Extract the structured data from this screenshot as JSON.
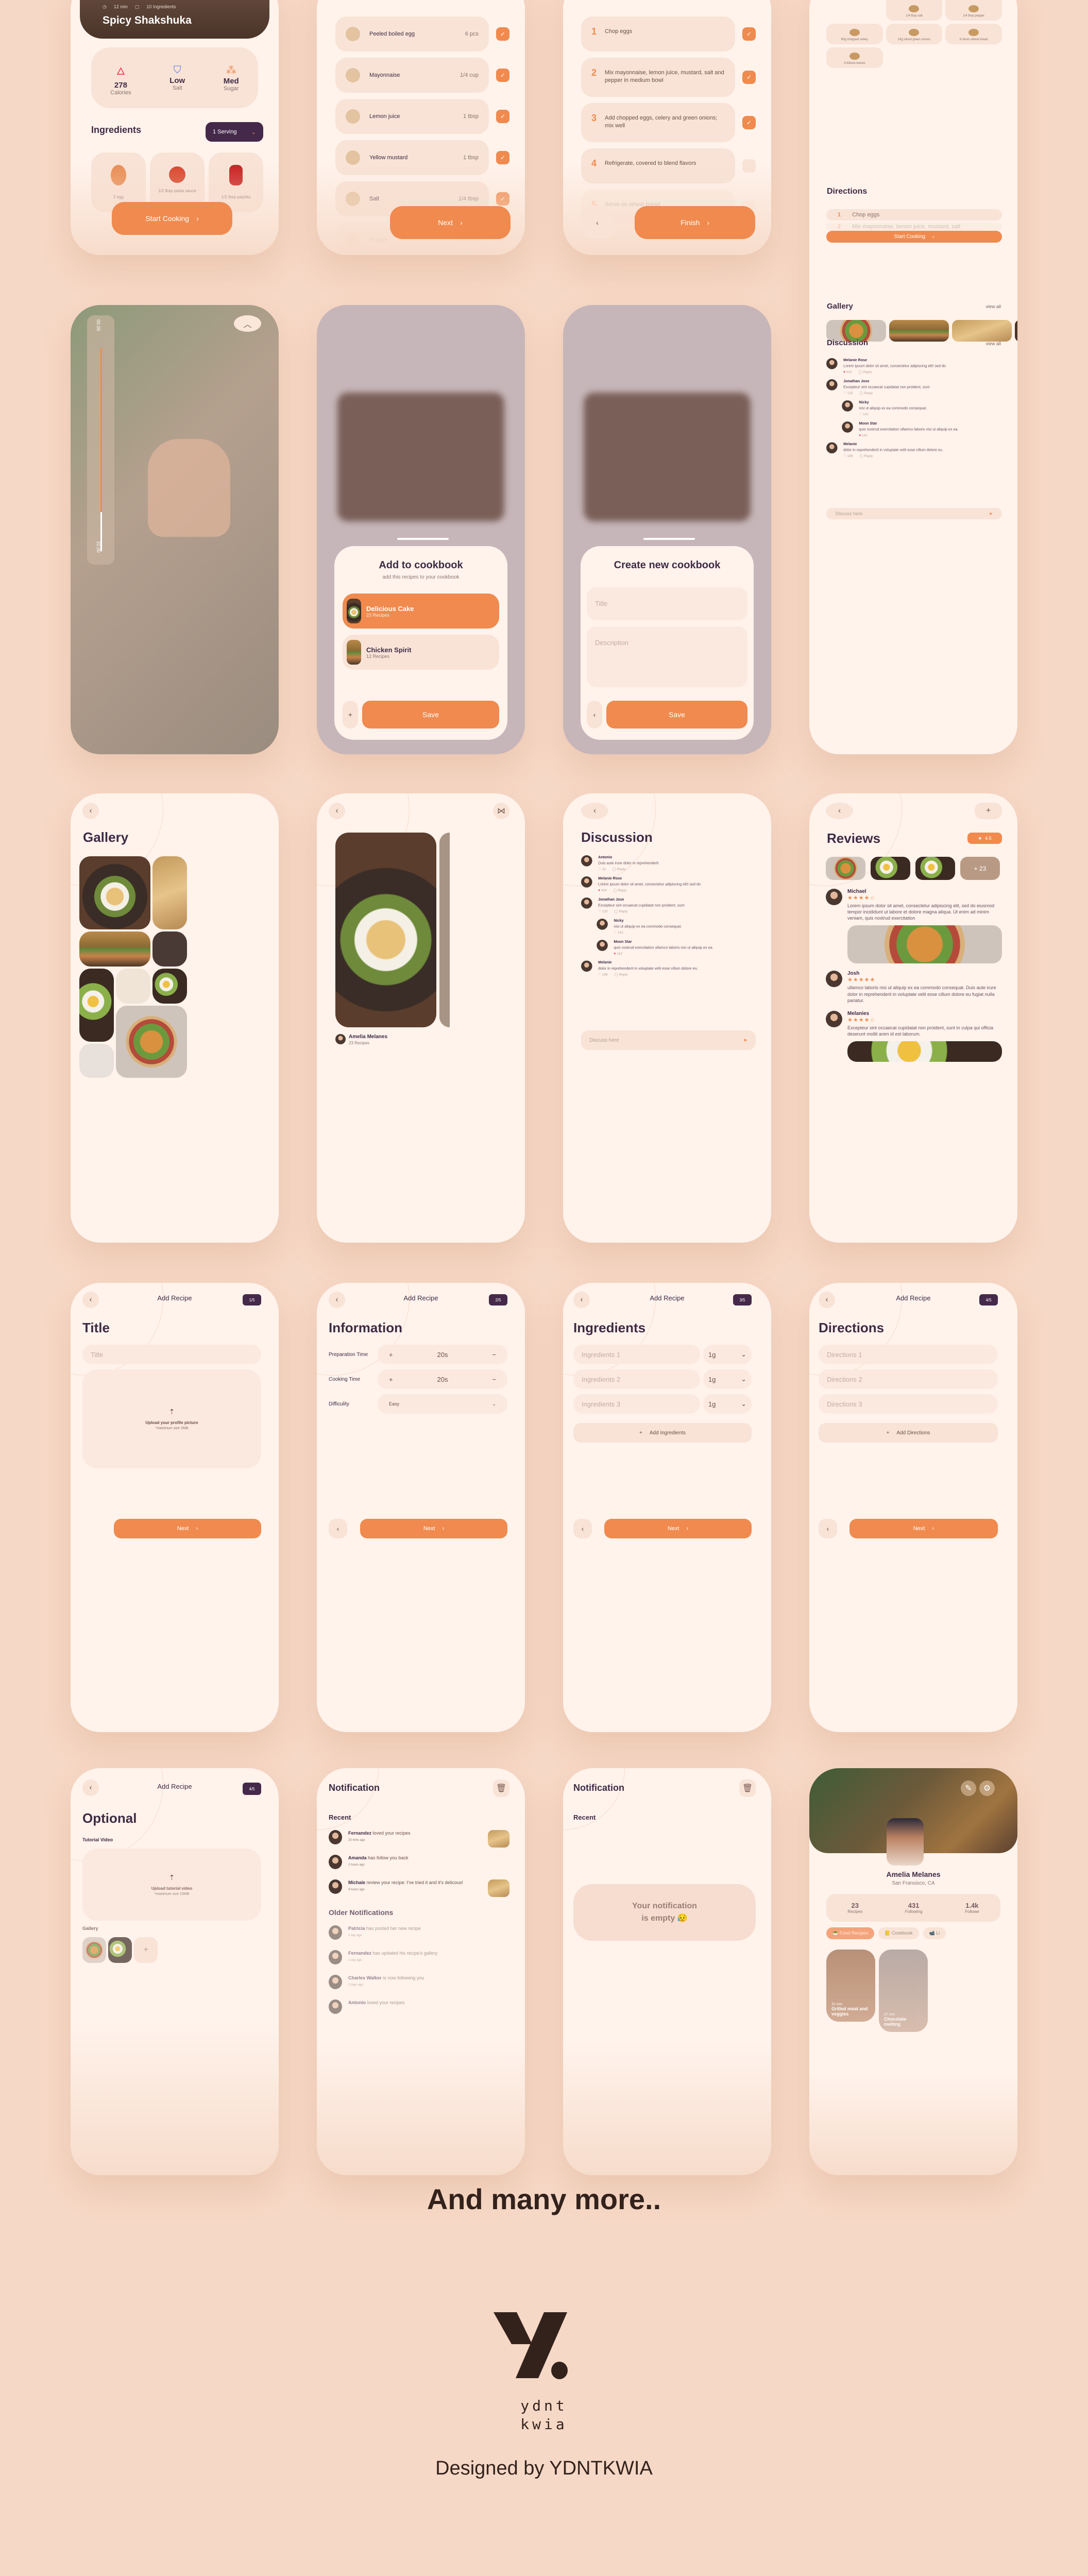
{
  "colors": {
    "accent": "#f08a4e",
    "dark": "#3e2a45",
    "background": "#f6d8c6",
    "card": "#fff3ec",
    "chip": "#f8e3d6",
    "heart": "#ef3b55"
  },
  "recipe": {
    "meta_time": "12 min",
    "meta_ingredients": "10 Ingredients",
    "title": "Spicy Shakshuka",
    "nutrition": [
      {
        "icon": "flame-icon",
        "value": "278",
        "label": "Calories"
      },
      {
        "icon": "salt-shaker-icon",
        "value": "Low",
        "label": "Salt"
      },
      {
        "icon": "sugar-cubes-icon",
        "value": "Med",
        "label": "Sugar"
      }
    ],
    "ingredients_title": "Ingredients",
    "serving_select": "1 Serving",
    "ingredients": [
      {
        "label": "2 egg"
      },
      {
        "label": "1/2 tbsp pasta sauce"
      },
      {
        "label": "1/2 tbsp paprika"
      }
    ],
    "start_button": "Start Cooking"
  },
  "checklist": {
    "items": [
      {
        "name": "Peeled boiled egg",
        "qty": "6 pcs",
        "checked": true
      },
      {
        "name": "Mayonnaise",
        "qty": "1/4 cup",
        "checked": true
      },
      {
        "name": "Lemon juice",
        "qty": "1 tbsp",
        "checked": true
      },
      {
        "name": "Yellow mustard",
        "qty": "1 tbsp",
        "checked": true
      },
      {
        "name": "Salt",
        "qty": "1/4 tbsp",
        "checked": true
      },
      {
        "name": "Pepper",
        "qty": "1/4 tbsp",
        "checked": false
      }
    ],
    "next_button": "Next"
  },
  "steps": {
    "items": [
      {
        "num": "1",
        "text": "Chop eggs",
        "checked": true
      },
      {
        "num": "2",
        "text": "Mix mayonnaise, lemon juice, mustard, salt and pepper in medium bowl",
        "checked": true
      },
      {
        "num": "3",
        "text": "Add chopped eggs, celery and green onions; mix well",
        "checked": true
      },
      {
        "num": "4",
        "text": "Refrigerate, covered to blend flavors",
        "checked": false
      },
      {
        "num": "5",
        "text": "Serve on wheat bread",
        "checked": false
      }
    ],
    "finish_button": "Finish"
  },
  "detail": {
    "ingredients": [
      "1 tbsp yellow mustard",
      "1/4 tbsp salt",
      "1/4 tbsp pepper",
      "60g chopped celery",
      "18g sliced green onions",
      "8 slices wheat bread",
      "4 lettuce leaves"
    ],
    "directions_title": "Directions",
    "directions": [
      {
        "num": "1",
        "text": "Chop eggs"
      },
      {
        "num": "2",
        "text": "Mix mayonnaise, lemon juice, mustard, salt"
      }
    ],
    "start_button": "Start Cooking",
    "gallery_title": "Gallery",
    "view_all": "view all",
    "discussion_title": "Discussion",
    "comments": [
      {
        "name": "Melanie Rose",
        "text": "Lorem ipsum dolor sit amet, consectetur adipiscing elit! sed do",
        "likes": "424",
        "liked": true,
        "reply": "Reply"
      },
      {
        "name": "Jonathan Jose",
        "text": "Excepteur sint occaecat cupidatat non proident, sunt",
        "likes": "125",
        "liked": false,
        "reply": "Reply"
      },
      {
        "name": "Nicky",
        "text": "nisi ut aliquip ex ea commodo consequat.",
        "likes": "142",
        "liked": false,
        "nested": true
      },
      {
        "name": "Moon Star",
        "text": "quis nostrud exercitation ullamco laboris nisi ut aliquip ex ea.",
        "likes": "142",
        "liked": true,
        "nested": true
      },
      {
        "name": "Melanie",
        "text": "dolor in reprehenderit in voluptate velit esse cillum dolore eu.",
        "likes": "186",
        "liked": false,
        "reply": "Reply"
      }
    ],
    "input_placeholder": "Discuss here"
  },
  "video": {
    "time_start": "00.00",
    "time_end": "32.00",
    "progress": 0.8
  },
  "cookbook": {
    "title": "Add to cookbook",
    "subtitle": "add this recipes to your cookbook",
    "books": [
      {
        "name": "Delicious Cake",
        "count": "23 Recipes",
        "selected": true
      },
      {
        "name": "Chicken Spirit",
        "count": "12 Recipes",
        "selected": false
      }
    ],
    "save_button": "Save"
  },
  "new_cookbook": {
    "title": "Create new cookbook",
    "title_placeholder": "Title",
    "description_placeholder": "Description",
    "save_button": "Save"
  },
  "gallery": {
    "title": "Gallery"
  },
  "photo": {
    "author": "Amelia Melanes",
    "recipes": "23 Recipes"
  },
  "discussion": {
    "title": "Discussion",
    "comments": [
      {
        "name": "Antonio",
        "text": "Duis aute irure dolor in reprehenderit",
        "likes": "32",
        "liked": false,
        "reply": "Reply"
      },
      {
        "name": "Melanie Rose",
        "text": "Lorem ipsum dolor sit amet, consectetur adipiscing elit! sed do",
        "likes": "424",
        "liked": true,
        "reply": "Reply"
      },
      {
        "name": "Jonathan Jose",
        "text": "Excepteur sint occaecat cupidatat non proident, sunt",
        "likes": "125",
        "liked": false,
        "reply": "Reply"
      },
      {
        "name": "Nicky",
        "text": "nisi ut aliquip ex ea commodo consequat.",
        "likes": "142",
        "liked": false,
        "nested": true
      },
      {
        "name": "Moon Star",
        "text": "quis nostrud exercitation ullamco laboris nisi ut aliquip ex ea.",
        "likes": "142",
        "liked": true,
        "nested": true
      },
      {
        "name": "Melanie",
        "text": "dolor in reprehenderit in voluptate velit esse cillum dolore eu.",
        "likes": "186",
        "liked": false,
        "reply": "Reply"
      }
    ],
    "input_placeholder": "Discuss here"
  },
  "reviews": {
    "title": "Reviews",
    "rating": "4.5",
    "more_photos": "+ 23",
    "items": [
      {
        "name": "Michael",
        "stars": 4,
        "text": "Lorem ipsum dolor sit amet, consectetur adipiscing elit, sed do eiusmod tempor incididunt ut labore et dolore magna aliqua. Ut enim ad minim veniam, quis nostrud exercitation",
        "photo": true
      },
      {
        "name": "Josh",
        "stars": 5,
        "text": "ullamco laboris nisi ut aliquip ex ea commodo consequat. Duis aute irure dolor in reprehenderit in voluptate velit esse cillum dolore eu fugiat nulla pariatur.",
        "photo": false
      },
      {
        "name": "Melanies",
        "stars": 4,
        "text": "Excepteur sint occaecat cupidatat non proident, sunt in culpa qui officia deserunt mollit anim id est laborum.",
        "photo": true
      }
    ]
  },
  "add_recipe": {
    "header": "Add Recipe",
    "next_button": "Next",
    "step1": {
      "step": "1/5",
      "title": "Title",
      "title_placeholder": "Title",
      "upload_label": "Upload your profile picture",
      "upload_hint": "*maximum size 2MB"
    },
    "step2": {
      "step": "2/5",
      "title": "Information",
      "rows": [
        {
          "label": "Preparation Time",
          "value": "20s"
        },
        {
          "label": "Cooking Time",
          "value": "20s"
        }
      ],
      "difficulty_label": "Difficulity",
      "difficulty_value": "Easy"
    },
    "step3": {
      "step": "3/5",
      "title": "Ingredients",
      "fields": [
        {
          "placeholder": "Ingredients 1",
          "unit": "1g"
        },
        {
          "placeholder": "Ingredients 2",
          "unit": "1g"
        },
        {
          "placeholder": "Ingredients 3",
          "unit": "1g"
        }
      ],
      "add_button": "Add Ingredients"
    },
    "step4": {
      "step": "4/5",
      "title": "Directions",
      "fields": [
        "Directions 1",
        "Directions 2",
        "Directions 3"
      ],
      "add_button": "Add Directions"
    },
    "step5": {
      "step": "4/5",
      "title": "Optional",
      "video_label": "Tutorial Video",
      "upload_label": "Upload tutorial video",
      "upload_hint": "*maximum size 10MB",
      "gallery_label": "Gallery"
    }
  },
  "notifications": {
    "title": "Notification",
    "recent": "Recent",
    "older": "Older Notifications",
    "recent_items": [
      {
        "name": "Fernandez",
        "text": " loved your recipes",
        "time": "23 mins ago",
        "thumb": true
      },
      {
        "name": "Amanda",
        "text": " has follow you back",
        "time": "2 hours ago",
        "thumb": false
      },
      {
        "name": "Michale",
        "text": " review your recipe: I've tried it and it's delicous!",
        "time": "4 hours ago",
        "thumb": true
      }
    ],
    "older_items": [
      {
        "name": "Patricia",
        "text": " has posted her new recipe",
        "time": "1 day ago"
      },
      {
        "name": "Fernandez",
        "text": " has updated his recipe's gallery",
        "time": "1 day ago"
      },
      {
        "name": "Charles Walker",
        "text": " is now following you",
        "time": "2 days ago"
      },
      {
        "name": "Antonio",
        "text": " loved your recipes",
        "time": ""
      }
    ]
  },
  "empty_notifications": {
    "title": "Notification",
    "recent": "Recent",
    "empty_line1": "Your notification",
    "empty_line2": "is empty 😥"
  },
  "profile": {
    "name": "Amelia Melanes",
    "location": "San Fransisco, CA",
    "stats": [
      {
        "value": "23",
        "label": "Recipes"
      },
      {
        "value": "431",
        "label": "Following"
      },
      {
        "value": "1.4k",
        "label": "Followe"
      }
    ],
    "tabs": [
      {
        "emoji": "🥗",
        "label": "Food Recipes",
        "active": true
      },
      {
        "emoji": "📒",
        "label": "Cookbook",
        "active": false
      },
      {
        "emoji": "📹",
        "label": "Li",
        "active": false
      }
    ],
    "cards": [
      {
        "time": "31 min",
        "title": "Grilled meat and veggies"
      },
      {
        "time": "27 min",
        "title": "Chocolate melting"
      }
    ]
  },
  "footer": {
    "tagline": "And many more..",
    "logo_line1": "ydnt",
    "logo_line2": "kwia",
    "credit": "Designed by YDNTKWIA"
  }
}
